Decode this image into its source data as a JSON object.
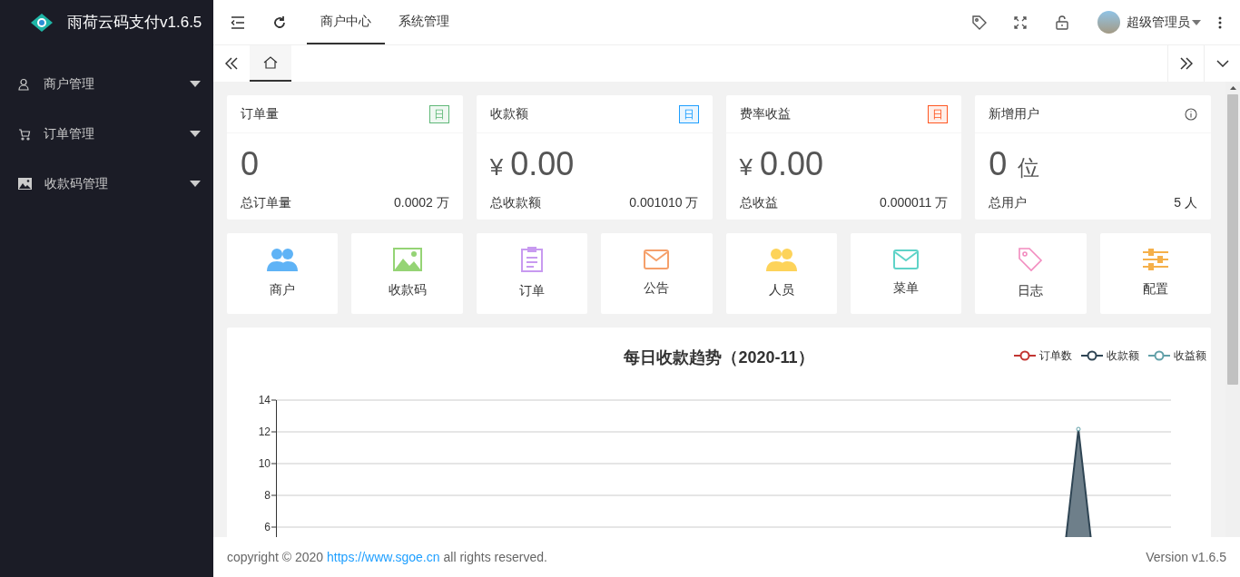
{
  "sidebar": {
    "logo_text": "雨荷云码支付v1.6.5",
    "items": [
      {
        "kind": "user",
        "label": "商户管理",
        "expanded": false
      },
      {
        "kind": "cart",
        "label": "订单管理",
        "expanded": false
      },
      {
        "kind": "image",
        "label": "收款码管理",
        "expanded": false
      }
    ]
  },
  "top_tabs": [
    {
      "label": "商户中心",
      "selected": true
    },
    {
      "label": "系统管理",
      "selected": false
    }
  ],
  "user": {
    "name": "超级管理员"
  },
  "page_tabs": [
    {
      "kind": "home",
      "selected": true
    }
  ],
  "stat_cards": [
    {
      "title": "订单量",
      "badge": "日",
      "color": "#5fb878",
      "value": "0",
      "footer_label": "总订单量",
      "footer_value": "0.0002 万"
    },
    {
      "title": "收款额",
      "badge": "日",
      "color": "#1e9fff",
      "value": "0.00",
      "prefix": "¥",
      "footer_label": "总收款额",
      "footer_value": "0.001010 万"
    },
    {
      "title": "费率收益",
      "badge": "日",
      "color": "#ff5722",
      "value": "0.00",
      "prefix": "¥",
      "footer_label": "总收益",
      "footer_value": "0.000011 万"
    },
    {
      "title": "新增用户",
      "value": "0",
      "unit": "位",
      "footer_label": "总用户",
      "footer_value": "5 人"
    }
  ],
  "shortcuts": [
    {
      "kind": "users",
      "label": "商户",
      "color": "#5fb3f6"
    },
    {
      "kind": "image",
      "label": "收款码",
      "color": "#95d475"
    },
    {
      "kind": "clipboard",
      "label": "订单",
      "color": "#c89af0"
    },
    {
      "kind": "mail",
      "label": "公告",
      "color": "#f5a06b"
    },
    {
      "kind": "users",
      "label": "人员",
      "color": "#fdd35a"
    },
    {
      "kind": "mail",
      "label": "菜单",
      "color": "#5fd3c8"
    },
    {
      "kind": "tag",
      "label": "日志",
      "color": "#f28bbf"
    },
    {
      "kind": "sliders",
      "label": "配置",
      "color": "#f5b04a"
    }
  ],
  "chart": {
    "title": "每日收款趋势（2020-11）",
    "legend": [
      {
        "label": "订单数",
        "color": "#c23531"
      },
      {
        "label": "收款额",
        "color": "#2f4554"
      },
      {
        "label": "收益额",
        "color": "#61a0a8"
      }
    ],
    "y_tick_labels": [
      "14",
      "12",
      "10",
      "8",
      "6"
    ]
  },
  "footer": {
    "copyright": "copyright © 2020",
    "link": "https://www.sgoe.cn",
    "rights": "all rights reserved.",
    "version": "Version v1.6.5"
  }
}
